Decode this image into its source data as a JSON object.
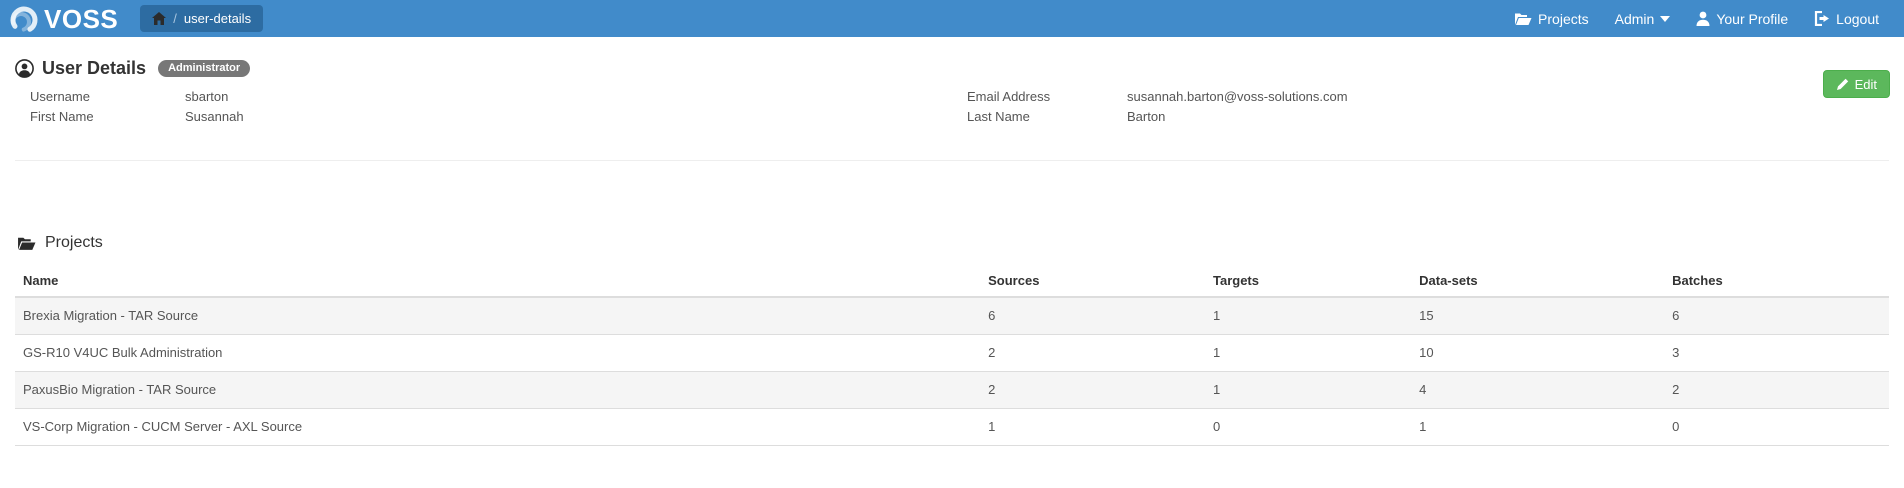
{
  "navbar": {
    "brand": "VOSS",
    "breadcrumb": {
      "separator": "/",
      "current": "user-details"
    },
    "items": [
      {
        "label": "Projects",
        "icon": "folder-open-icon"
      },
      {
        "label": "Admin",
        "icon": "caret-down-icon"
      },
      {
        "label": "Your Profile",
        "icon": "user-icon"
      },
      {
        "label": "Logout",
        "icon": "logout-icon"
      }
    ]
  },
  "user_details": {
    "title": "User Details",
    "badge": "Administrator",
    "edit_label": "Edit",
    "fields": {
      "username": {
        "label": "Username",
        "value": "sbarton"
      },
      "first_name": {
        "label": "First Name",
        "value": "Susannah"
      },
      "email": {
        "label": "Email Address",
        "value": "susannah.barton@voss-solutions.com"
      },
      "last_name": {
        "label": "Last Name",
        "value": "Barton"
      }
    }
  },
  "projects": {
    "title": "Projects",
    "columns": [
      "Name",
      "Sources",
      "Targets",
      "Data-sets",
      "Batches"
    ],
    "rows": [
      {
        "name": "Brexia Migration - TAR Source",
        "sources": "6",
        "targets": "1",
        "datasets": "15",
        "batches": "6"
      },
      {
        "name": "GS-R10 V4UC Bulk Administration",
        "sources": "2",
        "targets": "1",
        "datasets": "10",
        "batches": "3"
      },
      {
        "name": "PaxusBio Migration - TAR Source",
        "sources": "2",
        "targets": "1",
        "datasets": "4",
        "batches": "2"
      },
      {
        "name": "VS-Corp Migration - CUCM Server - AXL Source",
        "sources": "1",
        "targets": "0",
        "datasets": "1",
        "batches": "0"
      }
    ]
  },
  "colors": {
    "navbar_bg": "#418bca",
    "breadcrumb_bg": "#2d6ca2",
    "edit_button_bg": "#5cb85c",
    "badge_bg": "#777777",
    "stripe_bg": "#f5f5f5"
  }
}
